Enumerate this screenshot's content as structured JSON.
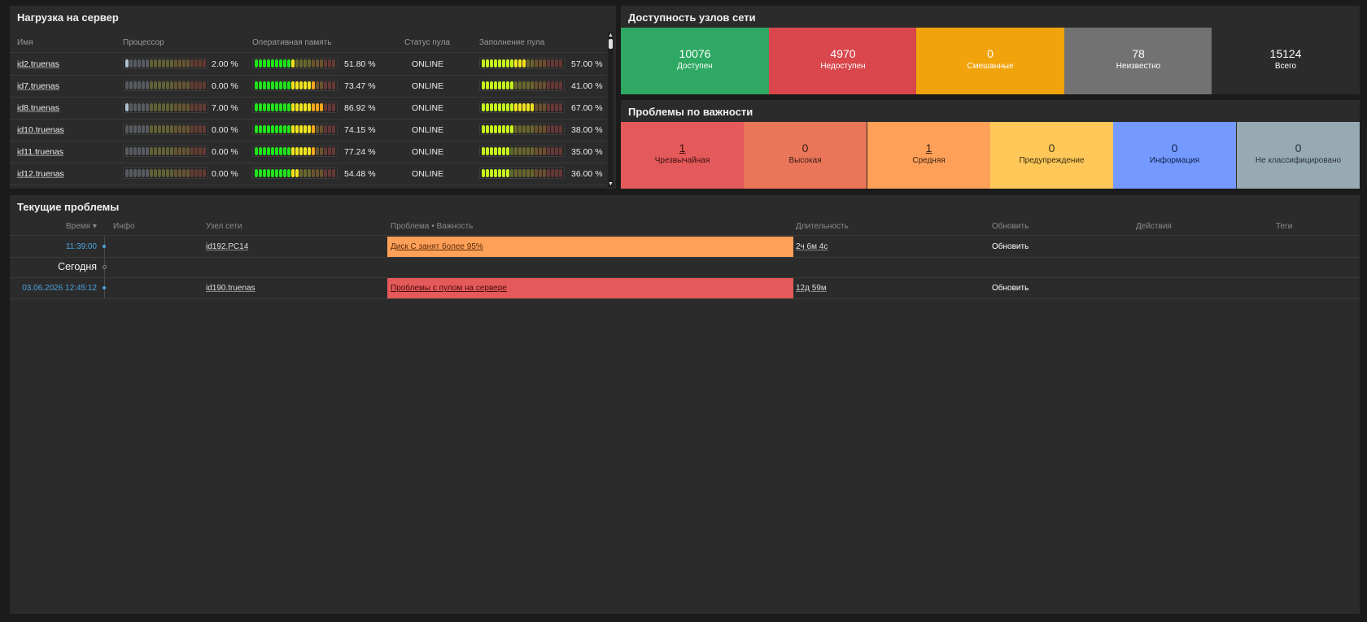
{
  "load": {
    "title": "Нагрузка на сервер",
    "headers": {
      "name": "Имя",
      "cpu": "Процессор",
      "ram": "Оперативная память",
      "pool_status": "Статус пула",
      "pool_fill": "Заполнение пула"
    },
    "rows": [
      {
        "name": "id2.truenas",
        "cpu": "2.00 %",
        "cpu_frac": 0.02,
        "ram": "51.80 %",
        "ram_frac": 0.518,
        "status": "ONLINE",
        "pool": "57.00 %",
        "pool_frac": 0.57
      },
      {
        "name": "id7.truenas",
        "cpu": "0.00 %",
        "cpu_frac": 0.0,
        "ram": "73.47 %",
        "ram_frac": 0.7347,
        "status": "ONLINE",
        "pool": "41.00 %",
        "pool_frac": 0.41
      },
      {
        "name": "id8.truenas",
        "cpu": "7.00 %",
        "cpu_frac": 0.07,
        "ram": "86.92 %",
        "ram_frac": 0.8692,
        "status": "ONLINE",
        "pool": "67.00 %",
        "pool_frac": 0.67
      },
      {
        "name": "id10.truenas",
        "cpu": "0.00 %",
        "cpu_frac": 0.0,
        "ram": "74.15 %",
        "ram_frac": 0.7415,
        "status": "ONLINE",
        "pool": "38.00 %",
        "pool_frac": 0.38
      },
      {
        "name": "id11.truenas",
        "cpu": "0.00 %",
        "cpu_frac": 0.0,
        "ram": "77.24 %",
        "ram_frac": 0.7724,
        "status": "ONLINE",
        "pool": "35.00 %",
        "pool_frac": 0.35
      },
      {
        "name": "id12.truenas",
        "cpu": "0.00 %",
        "cpu_frac": 0.0,
        "ram": "54.48 %",
        "ram_frac": 0.5448,
        "status": "ONLINE",
        "pool": "36.00 %",
        "pool_frac": 0.36
      }
    ]
  },
  "availability": {
    "title": "Доступность узлов сети",
    "cells": [
      {
        "value": "10076",
        "label": "Доступен",
        "color": "#2ea862"
      },
      {
        "value": "4970",
        "label": "Недоступен",
        "color": "#d9464c"
      },
      {
        "value": "0",
        "label": "Смешанные",
        "color": "#f0a30a"
      },
      {
        "value": "78",
        "label": "Неизвестно",
        "color": "#727272"
      },
      {
        "value": "15124",
        "label": "Всего",
        "color": "#2b2b2b"
      }
    ]
  },
  "severity": {
    "title": "Проблемы по важности",
    "cells": [
      {
        "value": "1",
        "label": "Чрезвычайная",
        "color": "#e45959",
        "text": "#3a1212",
        "link": true
      },
      {
        "value": "0",
        "label": "Высокая",
        "color": "#e97659",
        "text": "#3a1a12",
        "link": false
      },
      {
        "value": "1",
        "label": "Средняя",
        "color": "#ffa059",
        "text": "#3a2412",
        "link": true
      },
      {
        "value": "0",
        "label": "Предупреждение",
        "color": "#ffc859",
        "text": "#3a2d12",
        "link": false
      },
      {
        "value": "0",
        "label": "Информация",
        "color": "#7499ff",
        "text": "#12224a",
        "link": false
      },
      {
        "value": "0",
        "label": "Не классифицировано",
        "color": "#97aab3",
        "text": "#2a3136",
        "link": false
      }
    ]
  },
  "problems": {
    "title": "Текущие проблемы",
    "headers": {
      "time": "Время ▾",
      "info": "Инфо",
      "host": "Узел сети",
      "problem": "Проблема • Важность",
      "duration": "Длительность",
      "update": "Обновить",
      "actions": "Действия",
      "tags": "Теги"
    },
    "today_label": "Сегодня",
    "rows": [
      {
        "time": "11:39:00",
        "host": "id192.PC14",
        "problem": "Диск C занят более 95%",
        "color": "#ffa059",
        "duration": "2ч 6м 4с",
        "update": "Обновить"
      },
      {
        "time": "03.06.2026 12:45:12",
        "host": "id190.truenas",
        "problem": "Проблемы с пулом на сервере",
        "color": "#e45959",
        "duration": "12д 59м",
        "update": "Обновить"
      }
    ]
  },
  "colors": {
    "time_link": "#4aa3df",
    "widget_bg": "#2b2b2b",
    "page_bg": "#1b1b1b"
  }
}
